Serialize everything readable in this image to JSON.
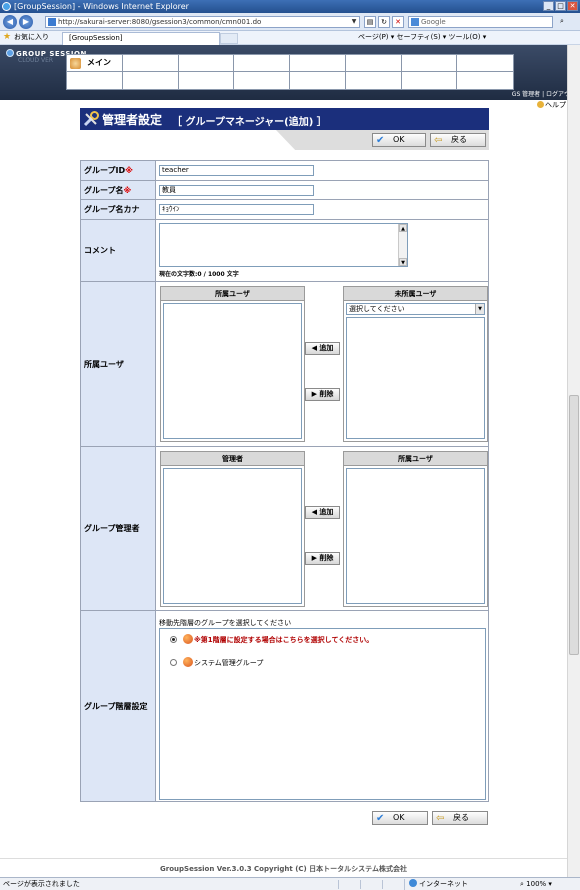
{
  "browser": {
    "window_title": "[GroupSession] - Windows Internet Explorer",
    "url": "http://sakurai-server:8080/gsession3/common/cmn001.do",
    "search_placeholder": "Google",
    "favorites_label": "お気に入り",
    "tab_title": "[GroupSession]",
    "toolbar_items": "ページ(P) ▾  セーフティ(S) ▾  ツール(O) ▾",
    "status_text": "ページが表示されました",
    "zone_text": "インターネット",
    "zoom_text": "100%"
  },
  "app": {
    "logo": "GROUP SESSION",
    "logo_sub": "CLOUD VER",
    "menu_main": "メイン",
    "user_links": "GS 管理者 | ログアウト",
    "help": "ヘルプ"
  },
  "page": {
    "title": "管理者設定",
    "subtitle": "［ グループマネージャー(追加) ］",
    "ok_label": "OK",
    "back_label": "戻る"
  },
  "form": {
    "group_id_label": "グループID",
    "group_id_value": "teacher",
    "group_name_label": "グループ名",
    "group_name_value": "教員",
    "group_kana_label": "グループ名カナ",
    "group_kana_value": "ｷｮｳｲﾝ",
    "required_mark": "※",
    "comment_label": "コメント",
    "comment_counter": "現在の文字数:0 / 1000 文字",
    "members_label": "所属ユーザ",
    "members_pane_left": "所属ユーザ",
    "members_pane_right": "未所属ユーザ",
    "members_select_value": "選択してください",
    "add_label": "◀ 追加",
    "remove_label": "▶ 削除",
    "admin_label": "グループ管理者",
    "admin_pane_left": "管理者",
    "admin_pane_right": "所属ユーザ",
    "hierarchy_label": "グループ階層設定",
    "hierarchy_hint": "移動先階層のグループを選択してください",
    "hierarchy_option1": "※第1階層に設定する場合はこちらを選択してください。",
    "hierarchy_option2": "システム管理グループ"
  },
  "footer": {
    "copyright": "GroupSession Ver.3.0.3 Copyright (C) 日本トータルシステム株式会社"
  }
}
